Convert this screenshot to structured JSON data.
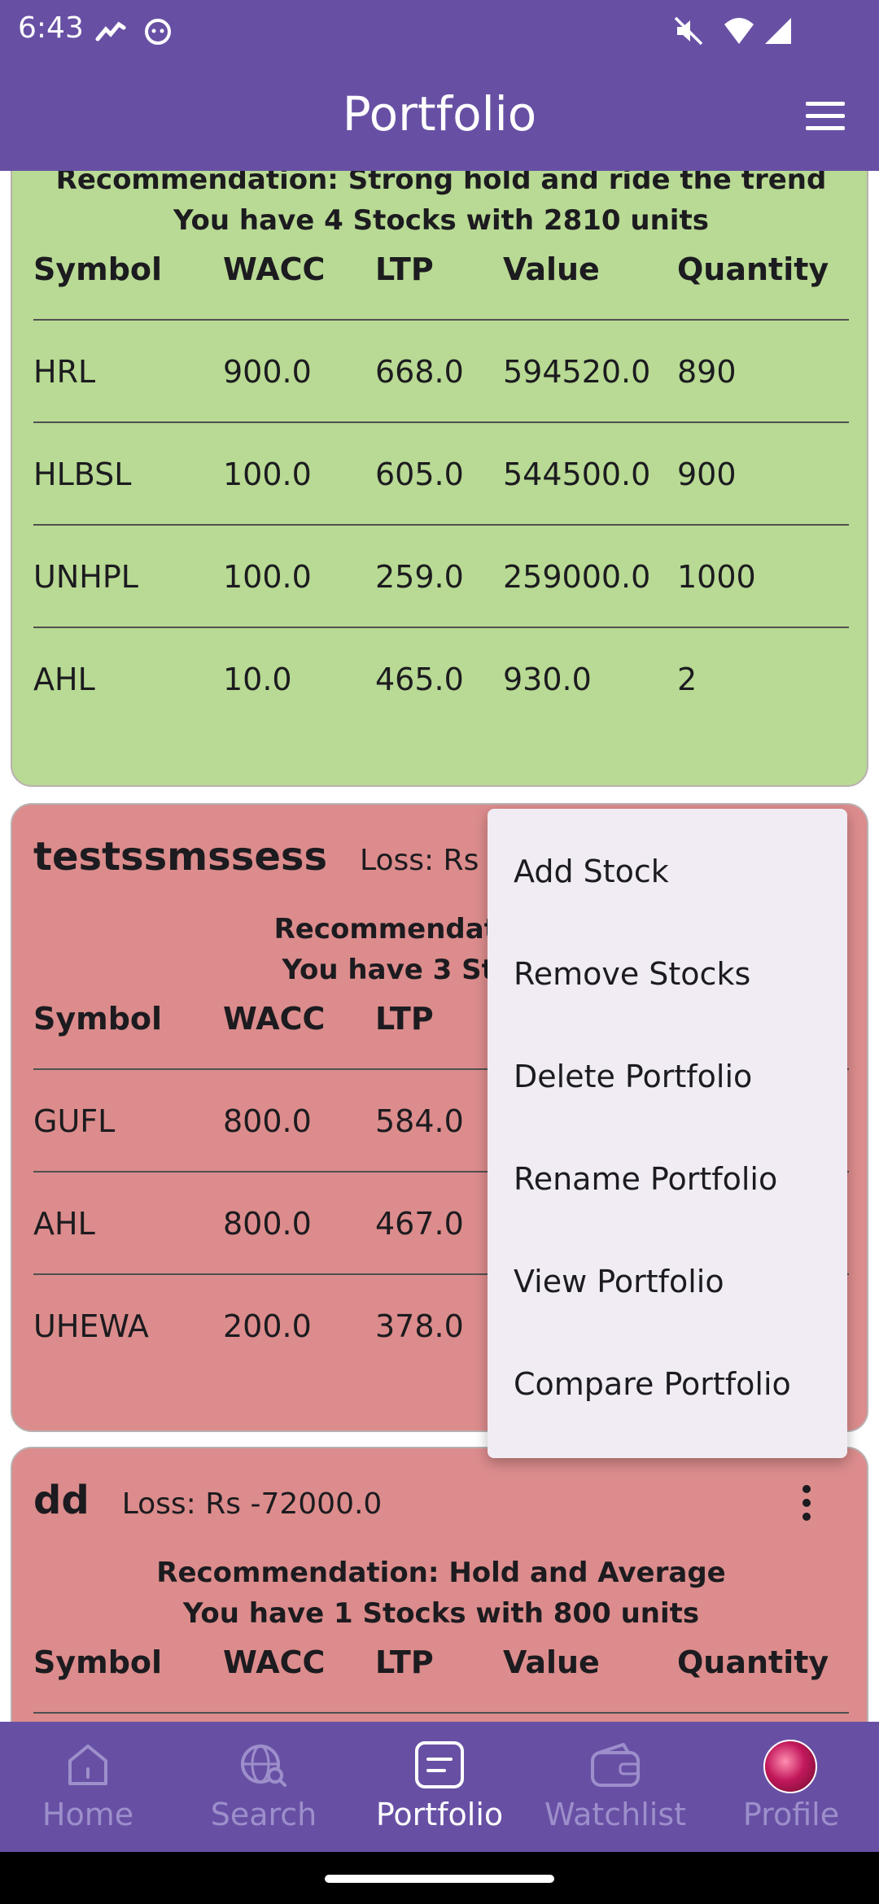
{
  "status_bar": {
    "time": "6:43",
    "icons": [
      "chart-icon",
      "cat-face-icon",
      "mute-icon",
      "wifi-icon",
      "signal-icon"
    ]
  },
  "app_bar": {
    "title": "Portfolio",
    "menu_icon": "hamburger-menu-icon"
  },
  "colors": {
    "primary": "#6750a4",
    "card_profit": "#b8da94",
    "card_loss": "#dc8c8c",
    "menu_bg": "#f1ecf4"
  },
  "table_headers": [
    "Symbol",
    "WACC",
    "LTP",
    "Value",
    "Quantity"
  ],
  "portfolios": [
    {
      "name": "",
      "loss": "",
      "recommendation": "Recommendation:  Strong hold and ride the trend",
      "summary": "You have 4 Stocks with 2810 units",
      "rows": [
        [
          "HRL",
          "900.0",
          "668.0",
          "594520.0",
          "890"
        ],
        [
          "HLBSL",
          "100.0",
          "605.0",
          "544500.0",
          "900"
        ],
        [
          "UNHPL",
          "100.0",
          "259.0",
          "259000.0",
          "1000"
        ],
        [
          "AHL",
          "10.0",
          "465.0",
          "930.0",
          "2"
        ]
      ]
    },
    {
      "name": "testssmssess",
      "loss": "Loss: Rs -40",
      "recommendation": "Recommendation:  Ho",
      "summary": "You have 3 Stocks w",
      "rows": [
        [
          "GUFL",
          "800.0",
          "584.0",
          "",
          ""
        ],
        [
          "AHL",
          "800.0",
          "467.0",
          "",
          ""
        ],
        [
          "UHEWA",
          "200.0",
          "378.0",
          "",
          ""
        ]
      ]
    },
    {
      "name": "dd",
      "loss": "Loss: Rs -72000.0",
      "recommendation": "Recommendation:  Hold and Average",
      "summary": "You have 1 Stocks with 800 units",
      "rows": []
    }
  ],
  "context_menu": {
    "items": [
      "Add Stock",
      "Remove Stocks",
      "Delete Portfolio",
      "Rename Portfolio",
      "View Portfolio",
      "Compare Portfolio"
    ]
  },
  "bottom_nav": {
    "items": [
      {
        "label": "Home",
        "icon": "home-icon",
        "active": false
      },
      {
        "label": "Search",
        "icon": "globe-search-icon",
        "active": false
      },
      {
        "label": "Portfolio",
        "icon": "portfolio-icon",
        "active": true
      },
      {
        "label": "Watchlist",
        "icon": "wallet-icon",
        "active": false
      },
      {
        "label": "Profile",
        "icon": "avatar",
        "active": false
      }
    ]
  }
}
